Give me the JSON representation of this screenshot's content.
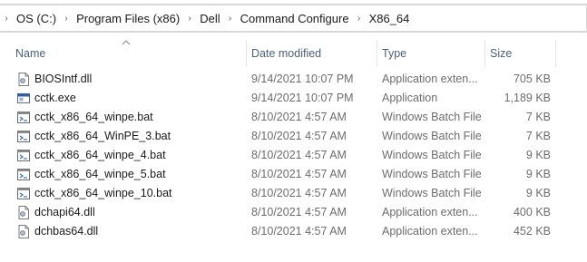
{
  "breadcrumb": {
    "items": [
      "OS (C:)",
      "Program Files (x86)",
      "Dell",
      "Command Configure",
      "X86_64"
    ]
  },
  "columns": {
    "name": "Name",
    "date": "Date modified",
    "type": "Type",
    "size": "Size"
  },
  "files": [
    {
      "name": "BIOSIntf.dll",
      "date": "9/14/2021 10:07 PM",
      "type": "Application exten...",
      "size": "705 KB",
      "icon": "dll-file-icon"
    },
    {
      "name": "cctk.exe",
      "date": "9/14/2021 10:07 PM",
      "type": "Application",
      "size": "1,189 KB",
      "icon": "exe-file-icon"
    },
    {
      "name": "cctk_x86_64_winpe.bat",
      "date": "8/10/2021 4:57 AM",
      "type": "Windows Batch File",
      "size": "7 KB",
      "icon": "bat-file-icon"
    },
    {
      "name": "cctk_x86_64_WinPE_3.bat",
      "date": "8/10/2021 4:57 AM",
      "type": "Windows Batch File",
      "size": "7 KB",
      "icon": "bat-file-icon"
    },
    {
      "name": "cctk_x86_64_winpe_4.bat",
      "date": "8/10/2021 4:57 AM",
      "type": "Windows Batch File",
      "size": "9 KB",
      "icon": "bat-file-icon"
    },
    {
      "name": "cctk_x86_64_winpe_5.bat",
      "date": "8/10/2021 4:57 AM",
      "type": "Windows Batch File",
      "size": "9 KB",
      "icon": "bat-file-icon"
    },
    {
      "name": "cctk_x86_64_winpe_10.bat",
      "date": "8/10/2021 4:57 AM",
      "type": "Windows Batch File",
      "size": "9 KB",
      "icon": "bat-file-icon"
    },
    {
      "name": "dchapi64.dll",
      "date": "8/10/2021 4:57 AM",
      "type": "Application exten...",
      "size": "400 KB",
      "icon": "dll-file-icon"
    },
    {
      "name": "dchbas64.dll",
      "date": "8/10/2021 4:57 AM",
      "type": "Application exten...",
      "size": "452 KB",
      "icon": "dll-file-icon"
    }
  ]
}
